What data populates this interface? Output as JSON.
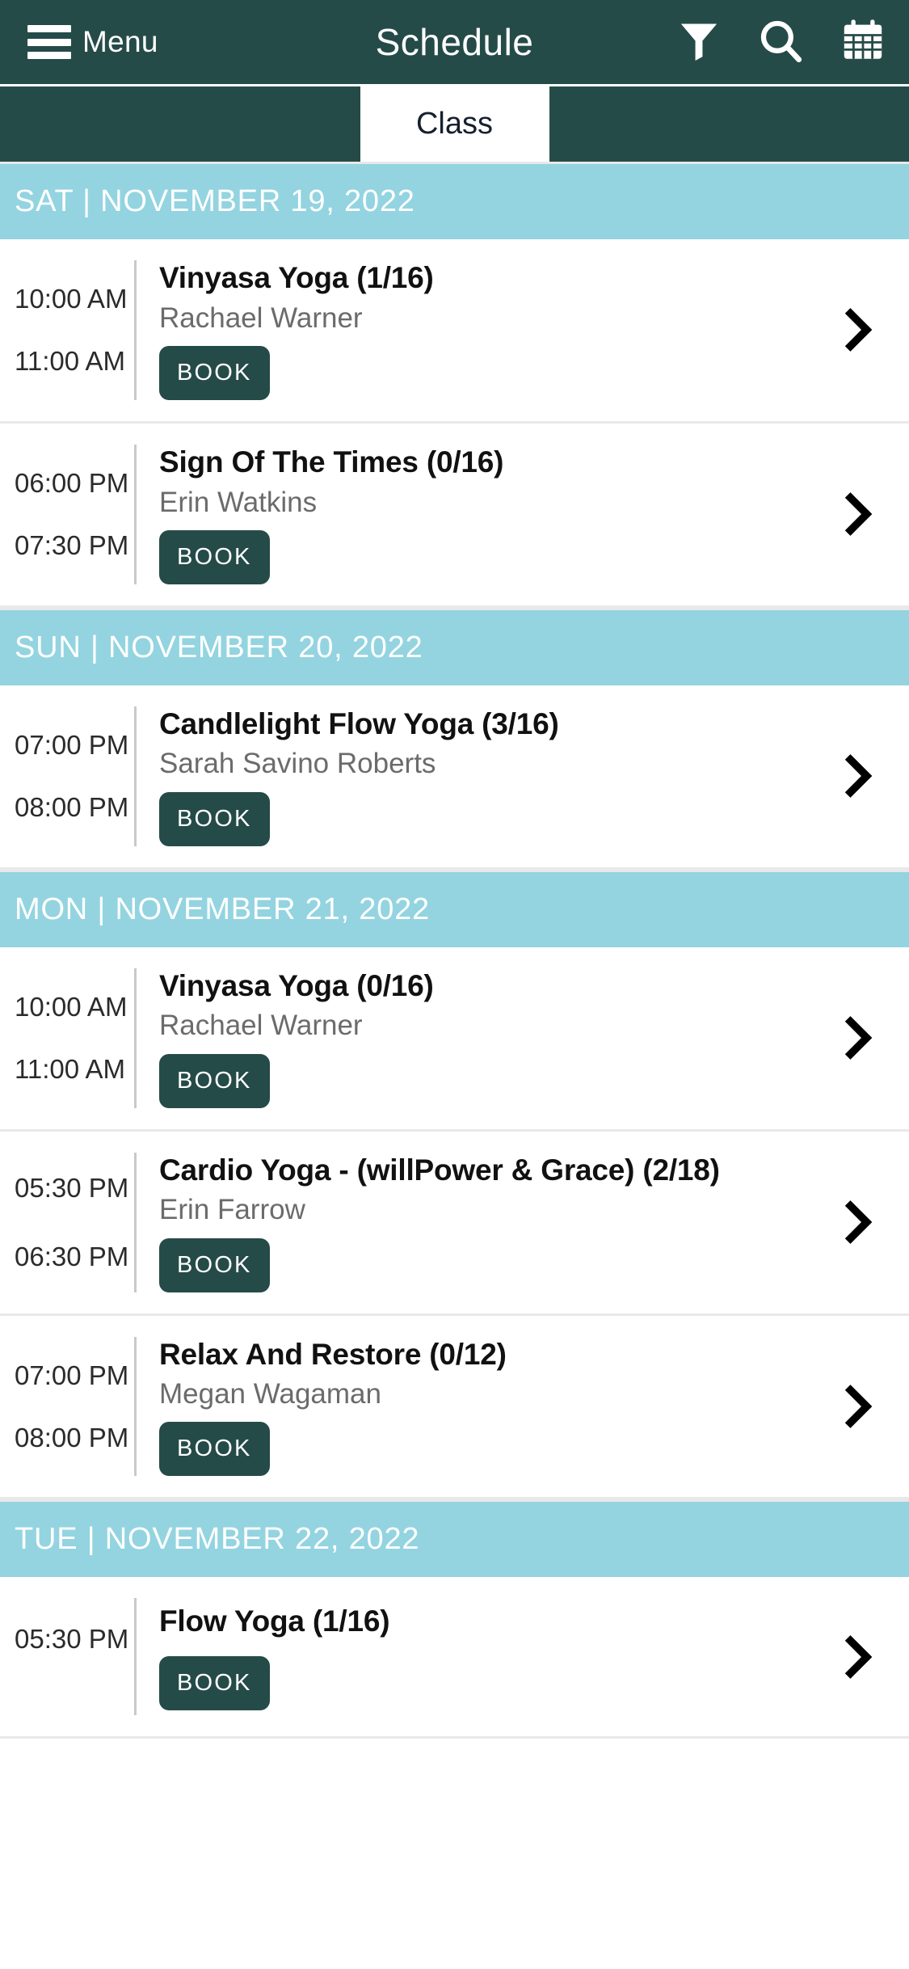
{
  "appbar": {
    "menu_label": "Menu",
    "title": "Schedule",
    "menu_icon": "hamburger-icon",
    "filter_icon": "filter-funnel-icon",
    "search_icon": "search-icon",
    "calendar_icon": "calendar-icon"
  },
  "tabs": [
    {
      "label": "",
      "active": false
    },
    {
      "label": "Class",
      "active": true
    },
    {
      "label": "",
      "active": false
    }
  ],
  "colors": {
    "header_bg": "#254b48",
    "day_band_bg": "#93d4e0",
    "book_button_bg": "#254b48",
    "page_bg": "#ffffff",
    "title_text": "#111111",
    "instructor_text": "#6b6b6b"
  },
  "book_label": "BOOK",
  "chevron_icon": "chevron-right-icon",
  "days": [
    {
      "header": "SAT | NOVEMBER 19, 2022",
      "classes": [
        {
          "start_time": "10:00 AM",
          "end_time": "11:00 AM",
          "title": "Vinyasa Yoga (1/16)",
          "instructor": "Rachael Warner",
          "book_label": "BOOK"
        },
        {
          "start_time": "06:00 PM",
          "end_time": "07:30 PM",
          "title": "Sign Of The Times (0/16)",
          "instructor": "Erin Watkins",
          "book_label": "BOOK"
        }
      ]
    },
    {
      "header": "SUN | NOVEMBER 20, 2022",
      "classes": [
        {
          "start_time": "07:00 PM",
          "end_time": "08:00 PM",
          "title": "Candlelight Flow Yoga (3/16)",
          "instructor": "Sarah Savino Roberts",
          "book_label": "BOOK"
        }
      ]
    },
    {
      "header": "MON | NOVEMBER 21, 2022",
      "classes": [
        {
          "start_time": "10:00 AM",
          "end_time": "11:00 AM",
          "title": "Vinyasa Yoga (0/16)",
          "instructor": "Rachael Warner",
          "book_label": "BOOK"
        },
        {
          "start_time": "05:30 PM",
          "end_time": "06:30 PM",
          "title": "Cardio Yoga - (willPower & Grace) (2/18)",
          "instructor": "Erin Farrow",
          "book_label": "BOOK"
        },
        {
          "start_time": "07:00 PM",
          "end_time": "08:00 PM",
          "title": "Relax And Restore (0/12)",
          "instructor": "Megan Wagaman",
          "book_label": "BOOK"
        }
      ]
    },
    {
      "header": "TUE | NOVEMBER 22, 2022",
      "classes": [
        {
          "start_time": "05:30 PM",
          "end_time": "",
          "title": "Flow Yoga (1/16)",
          "instructor": "",
          "book_label": "BOOK"
        }
      ]
    }
  ]
}
